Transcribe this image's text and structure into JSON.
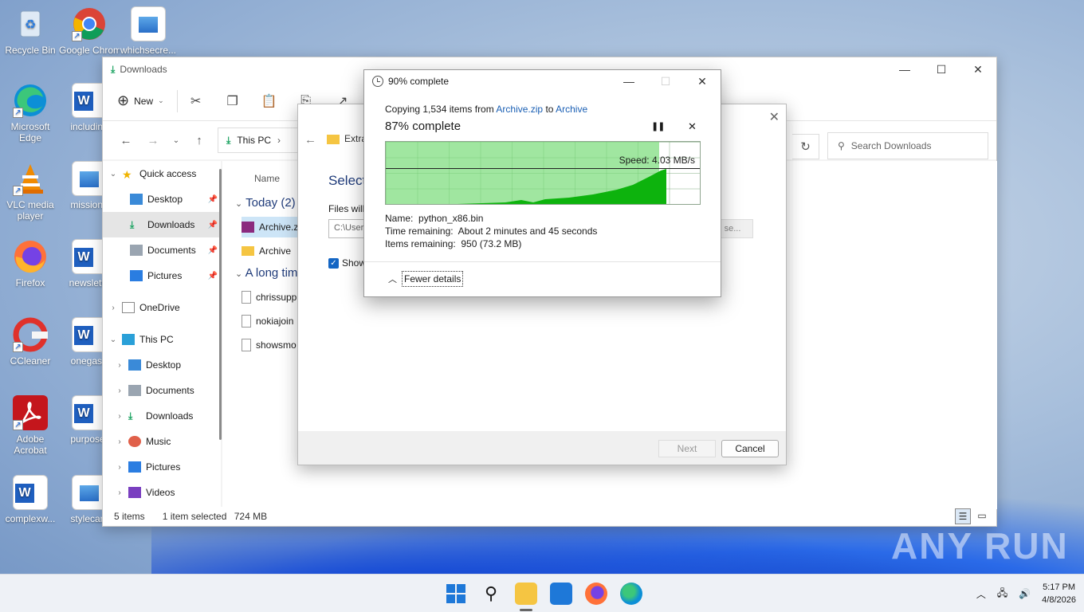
{
  "desktop": {
    "icons": [
      {
        "label": "Recycle Bin"
      },
      {
        "label": "Google Chrome"
      },
      {
        "label": "whichsecre..."
      },
      {
        "label": "Microsoft Edge"
      },
      {
        "label": "including"
      },
      {
        "label": "VLC media player"
      },
      {
        "label": "missiono"
      },
      {
        "label": "Firefox"
      },
      {
        "label": "newslette"
      },
      {
        "label": "CCleaner"
      },
      {
        "label": "onegas.r"
      },
      {
        "label": "Adobe Acrobat"
      },
      {
        "label": "purposer"
      },
      {
        "label": "complexw..."
      },
      {
        "label": "stylecam"
      }
    ]
  },
  "explorer": {
    "title": "Downloads",
    "toolbar": {
      "new_label": "New"
    },
    "address": {
      "crumb": "This PC"
    },
    "search_placeholder": "Search Downloads",
    "nav": [
      {
        "label": "Quick access"
      },
      {
        "label": "Desktop"
      },
      {
        "label": "Downloads"
      },
      {
        "label": "Documents"
      },
      {
        "label": "Pictures"
      },
      {
        "label": "OneDrive"
      },
      {
        "label": "This PC"
      },
      {
        "label": "Desktop"
      },
      {
        "label": "Documents"
      },
      {
        "label": "Downloads"
      },
      {
        "label": "Music"
      },
      {
        "label": "Pictures"
      },
      {
        "label": "Videos"
      }
    ],
    "column_name": "Name",
    "groups": {
      "today": "Today (2)",
      "long_time": "A long tim"
    },
    "files": [
      {
        "name": "Archive.zi"
      },
      {
        "name": "Archive"
      },
      {
        "name": "chrissupp"
      },
      {
        "name": "nokiajoin"
      },
      {
        "name": "showsmo"
      }
    ],
    "status": {
      "count": "5 items",
      "selected": "1 item selected",
      "size": "724 MB"
    }
  },
  "extract_dialog": {
    "title": "Extra",
    "heading": "Select",
    "files_label": "Files will",
    "path_value": "C:\\User",
    "browse_label": "se...",
    "checkbox_label": "Show",
    "next_label": "Next",
    "cancel_label": "Cancel"
  },
  "copy_dialog": {
    "title": "90% complete",
    "copying_prefix": "Copying 1,534 items from",
    "source": "Archive.zip",
    "to_word": "to",
    "destination": "Archive",
    "percent_text": "87% complete",
    "percent_value": 0.87,
    "speed_label": "Speed: 4.03 MB/s",
    "name_label": "Name:",
    "name_value": "python_x86.bin",
    "time_label": "Time remaining:",
    "time_value": "About 2 minutes and 45 seconds",
    "items_label": "Items remaining:",
    "items_value": "950 (73.2 MB)",
    "fewer_details": "Fewer details"
  },
  "taskbar": {
    "time": "5:17 PM",
    "date": "4/8/2026"
  },
  "watermark": "ANY RUN"
}
